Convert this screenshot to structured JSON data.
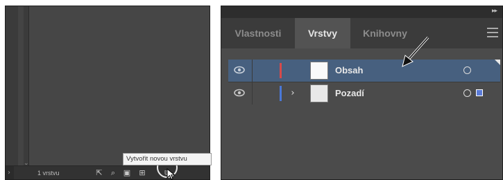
{
  "left_panel": {
    "layer_count": "1 vrstvu",
    "tooltip": "Vytvořit novou vrstvu",
    "tools": [
      {
        "name": "export-icon",
        "glyph": "⇱"
      },
      {
        "name": "search-icon",
        "glyph": "⌕"
      },
      {
        "name": "clipping-mask-icon",
        "glyph": "▣"
      },
      {
        "name": "new-sublayer-icon",
        "glyph": "⊞"
      },
      {
        "name": "new-layer-icon",
        "glyph": "⧉"
      },
      {
        "name": "delete-icon",
        "glyph": "🗑"
      }
    ]
  },
  "right_panel": {
    "tabs": [
      {
        "label": "Vlastnosti",
        "active": false
      },
      {
        "label": "Vrstvy",
        "active": true
      },
      {
        "label": "Knihovny",
        "active": false
      }
    ],
    "collapse_glyph": "▸▸",
    "layers": [
      {
        "name": "Obsah",
        "color": "#d84a4a",
        "selected": true,
        "expandable": false
      },
      {
        "name": "Pozadí",
        "color": "#4a78d8",
        "selected": false,
        "expandable": true
      }
    ]
  }
}
